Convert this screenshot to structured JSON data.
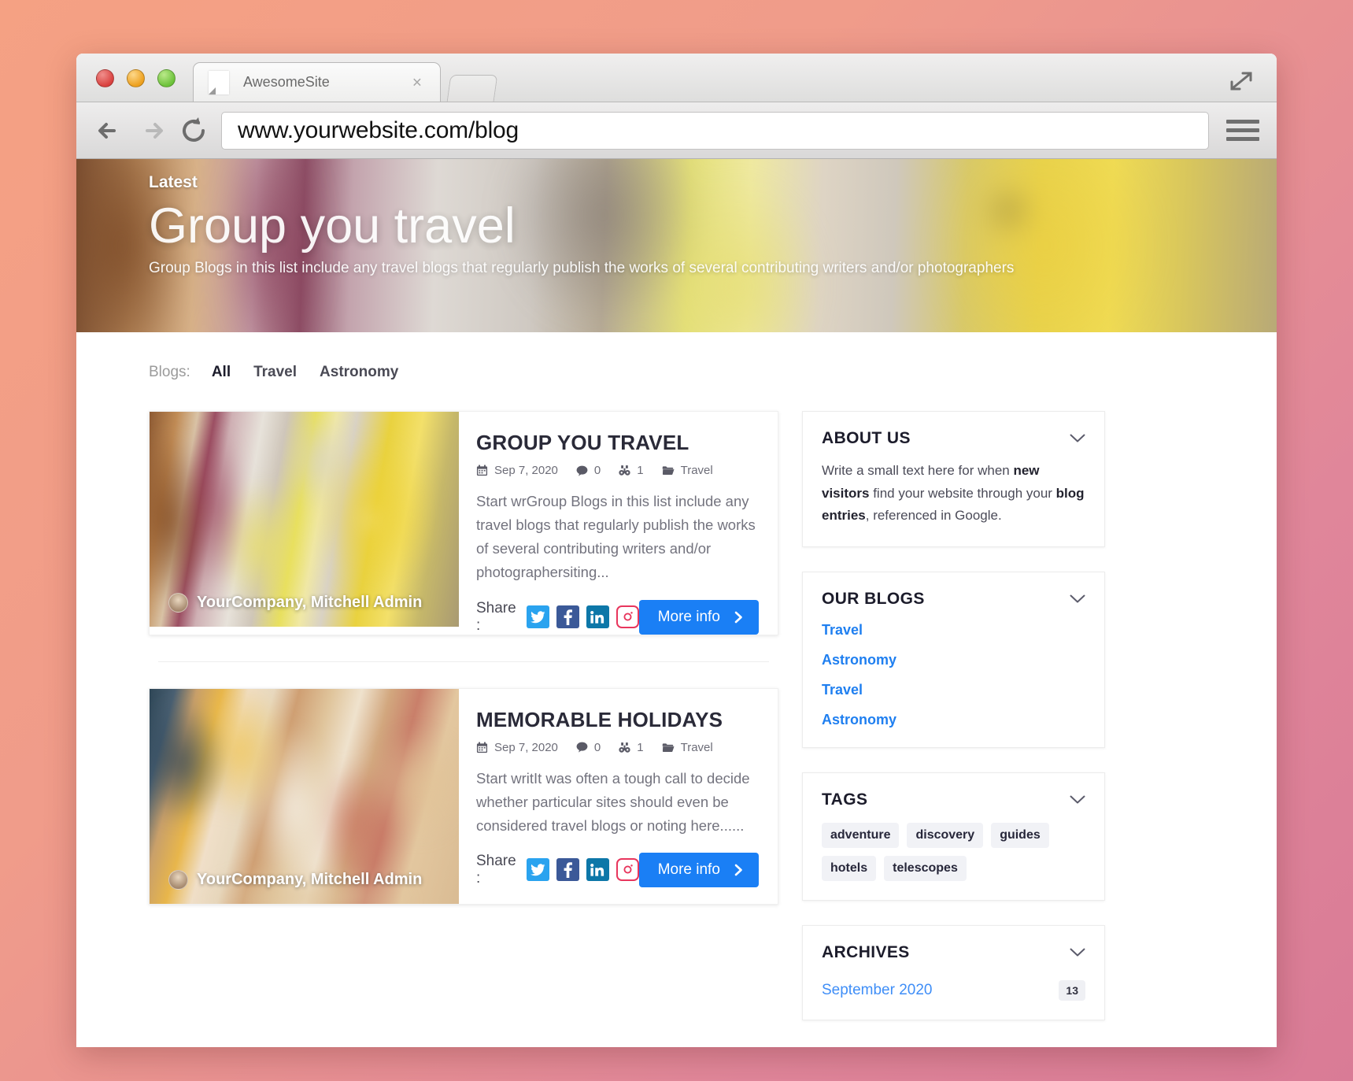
{
  "browser": {
    "tab_title": "AwesomeSite",
    "url": "www.yourwebsite.com/blog",
    "close_glyph": "×"
  },
  "hero": {
    "eyebrow": "Latest",
    "title": "Group you travel",
    "subtitle": "Group Blogs in this list include any travel blogs that regularly publish the works of several contributing writers and/or photographers"
  },
  "filter": {
    "label": "Blogs:",
    "items": [
      {
        "label": "All",
        "active": true
      },
      {
        "label": "Travel",
        "active": false
      },
      {
        "label": "Astronomy",
        "active": false
      }
    ]
  },
  "articles": [
    {
      "title": "GROUP YOU TRAVEL",
      "date": "Sep 7, 2020",
      "comments": "0",
      "views": "1",
      "category": "Travel",
      "excerpt": "Start wrGroup Blogs in this list include any travel blogs that regularly publish the works of several contributing writers and/or photographersiting...",
      "caption": "YourCompany, Mitchell Admin",
      "share_label": "Share :",
      "more_label": "More info"
    },
    {
      "title": "MEMORABLE HOLIDAYS",
      "date": "Sep 7, 2020",
      "comments": "0",
      "views": "1",
      "category": "Travel",
      "excerpt": "Start writIt was often a tough call to decide whether particular sites should even be considered travel blogs or noting here......",
      "caption": "YourCompany, Mitchell Admin",
      "share_label": "Share :",
      "more_label": "More info"
    }
  ],
  "sidebar": {
    "about": {
      "title": "ABOUT US",
      "text_1": "Write a small text here for when ",
      "bold_1": "new visitors",
      "text_2": " find your website through your ",
      "bold_2": "blog entries",
      "text_3": ", referenced in Google."
    },
    "blogs": {
      "title": "OUR BLOGS",
      "links": [
        "Travel",
        "Astronomy",
        "Travel",
        "Astronomy"
      ]
    },
    "tags": {
      "title": "TAGS",
      "items": [
        "adventure",
        "discovery",
        "guides",
        "hotels",
        "telescopes"
      ]
    },
    "archives": {
      "title": "ARCHIVES",
      "rows": [
        {
          "label": "September 2020",
          "count": "13"
        }
      ]
    }
  },
  "colors": {
    "accent_blue": "#1a7ff5",
    "link_blue": "#1f7ff0",
    "twitter": "#2aa3ef",
    "facebook": "#3b5998",
    "linkedin": "#0d77a8",
    "instagram": "#e8365d"
  }
}
